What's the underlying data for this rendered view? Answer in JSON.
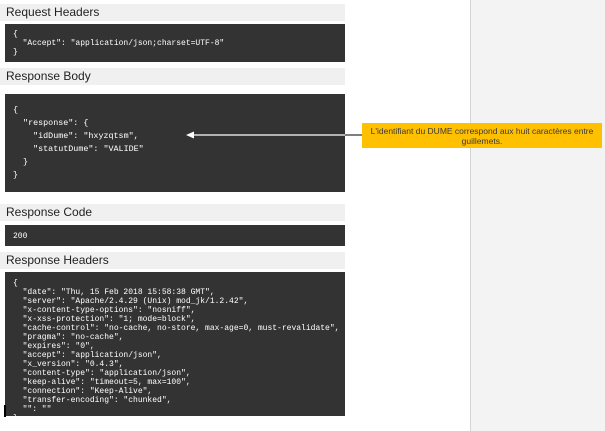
{
  "request_headers": {
    "title": "Request Headers",
    "code": "{\n  \"Accept\": \"application/json;charset=UTF-8\"\n}"
  },
  "response_body": {
    "title": "Response Body",
    "code": "{\n  \"response\": {\n    \"idDume\": \"hxyzqtsm\",\n    \"statutDume\": \"VALIDE\"\n  }\n}"
  },
  "response_code": {
    "title": "Response Code",
    "code": "200"
  },
  "response_headers": {
    "title": "Response Headers",
    "code": "{\n  \"date\": \"Thu, 15 Feb 2018 15:58:38 GMT\",\n  \"server\": \"Apache/2.4.29 (Unix) mod_jk/1.2.42\",\n  \"x-content-type-options\": \"nosniff\",\n  \"x-xss-protection\": \"1; mode=block\",\n  \"cache-control\": \"no-cache, no-store, max-age=0, must-revalidate\",\n  \"pragma\": \"no-cache\",\n  \"expires\": \"0\",\n  \"accept\": \"application/json\",\n  \"x_version\": \"0.4.3\",\n  \"content-type\": \"application/json\",\n  \"keep-alive\": \"timeout=5, max=100\",\n  \"connection\": \"Keep-Alive\",\n  \"transfer-encoding\": \"chunked\",\n  \"\": \"\"\n}"
  },
  "annotation": {
    "text": "L'identifiant du DUME correspond aux huit caractères entre guillemets."
  },
  "colors": {
    "code_background": "#333333",
    "section_background": "#f0f0f0",
    "annotation_background": "#ffc000"
  }
}
